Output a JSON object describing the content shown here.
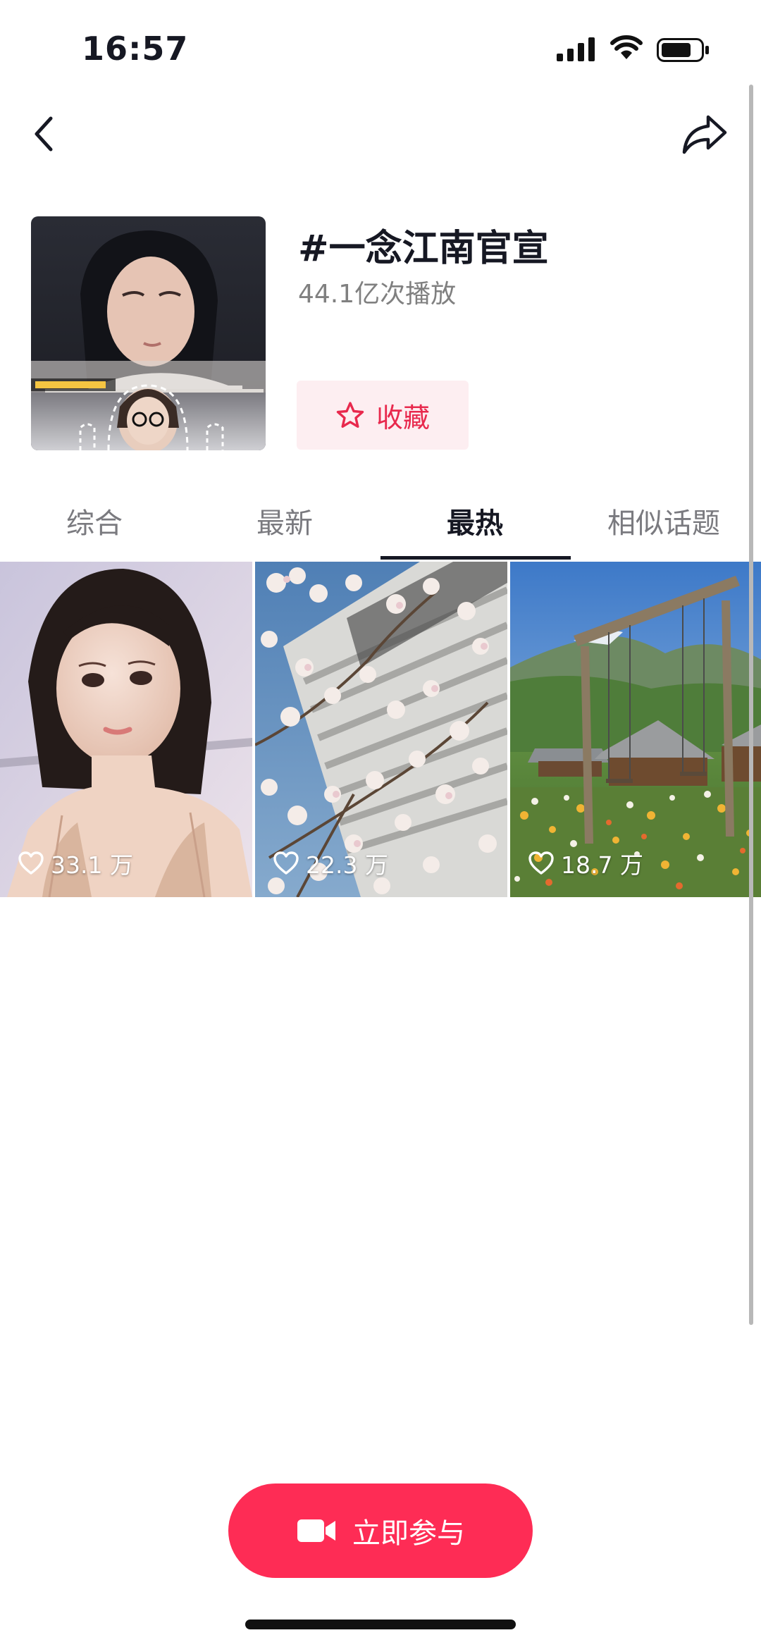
{
  "status_bar": {
    "time": "16:57"
  },
  "nav": {
    "back_icon": "chevron-left-icon",
    "share_icon": "share-arrow-icon"
  },
  "topic": {
    "title": "#一念江南官宣",
    "play_count": "44.1亿次播放",
    "favorite_label": "收藏"
  },
  "tabs": [
    {
      "label": "综合",
      "active": false
    },
    {
      "label": "最新",
      "active": false
    },
    {
      "label": "最热",
      "active": true
    },
    {
      "label": "相似话题",
      "active": false
    }
  ],
  "videos": [
    {
      "likes": "33.1 万"
    },
    {
      "likes": "22.3 万"
    },
    {
      "likes": "18.7 万"
    }
  ],
  "join_button": {
    "label": "立即参与",
    "icon": "video-camera-icon"
  },
  "colors": {
    "accent": "#fe2c55",
    "favorite_bg": "#fdeef1",
    "favorite_text": "#e8294d",
    "muted_text": "#808080"
  }
}
